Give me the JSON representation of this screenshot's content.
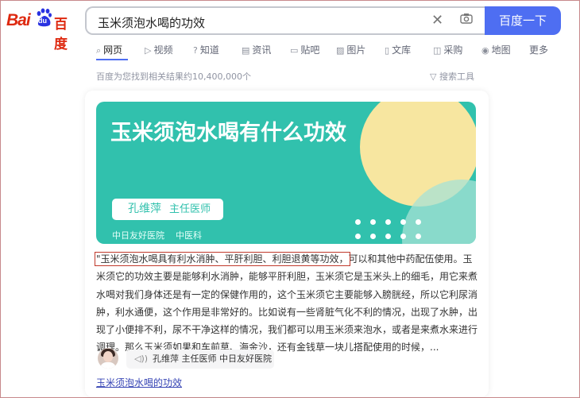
{
  "logo": {
    "bai": "Bai",
    "du": "du",
    "cn": "百度"
  },
  "search": {
    "query": "玉米须泡水喝的功效",
    "button": "百度一下",
    "clear_icon": "close-icon",
    "camera_icon": "camera-icon"
  },
  "tabs": [
    {
      "icon": "search-icon",
      "glyph": "⌕",
      "label": "网页",
      "active": true
    },
    {
      "icon": "video-icon",
      "glyph": "▷",
      "label": "视频"
    },
    {
      "icon": "question-icon",
      "glyph": "?",
      "label": "知道"
    },
    {
      "icon": "news-icon",
      "glyph": "▤",
      "label": "资讯"
    },
    {
      "icon": "forum-icon",
      "glyph": "▭",
      "label": "贴吧"
    },
    {
      "icon": "image-icon",
      "glyph": "▨",
      "label": "图片"
    },
    {
      "icon": "doc-icon",
      "glyph": "▯",
      "label": "文库"
    },
    {
      "icon": "purchase-icon",
      "glyph": "◫",
      "label": "采购"
    },
    {
      "icon": "map-icon",
      "glyph": "◉",
      "label": "地图"
    },
    {
      "label": "更多"
    }
  ],
  "result_count": "百度为您找到相关结果约10,400,000个",
  "search_tools": "搜索工具",
  "card": {
    "banner_title": "玉米须泡水喝有什么功效",
    "doctor_name": "孔维萍",
    "doctor_title": "主任医师",
    "hospital": "中日友好医院",
    "department": "中医科",
    "snippet_highlight": "\"玉米须泡水喝具有利水消肿、平肝利胆、利胆退黄等功效，",
    "snippet_rest": "可以和其他中药配伍使用。玉米须它的功效主要是能够利水消肿，能够平肝利胆，玉米须它是玉米头上的细毛，用它来煮水喝对我们身体还是有一定的保健作用的，这个玉米须它主要能够入膀胱经，所以它利尿消肿，利水通便，这个作用是非常好的。比如说有一些肾脏气化不利的情况，出现了水肿，出现了小便排不利，尿不干净这样的情况，我们都可以用玉米须来泡水，或者是来煮水来进行调理。那么玉米须如果和车前草、海金沙，还有金钱草一块儿搭配使用的时候，...",
    "author_line": "孔维萍 主任医师 中日友好医院",
    "link": "玉米须泡水喝的功效"
  },
  "colors": {
    "brand_red": "#de2910",
    "button_blue": "#4e6ef2",
    "banner_teal": "#31c1ad"
  }
}
